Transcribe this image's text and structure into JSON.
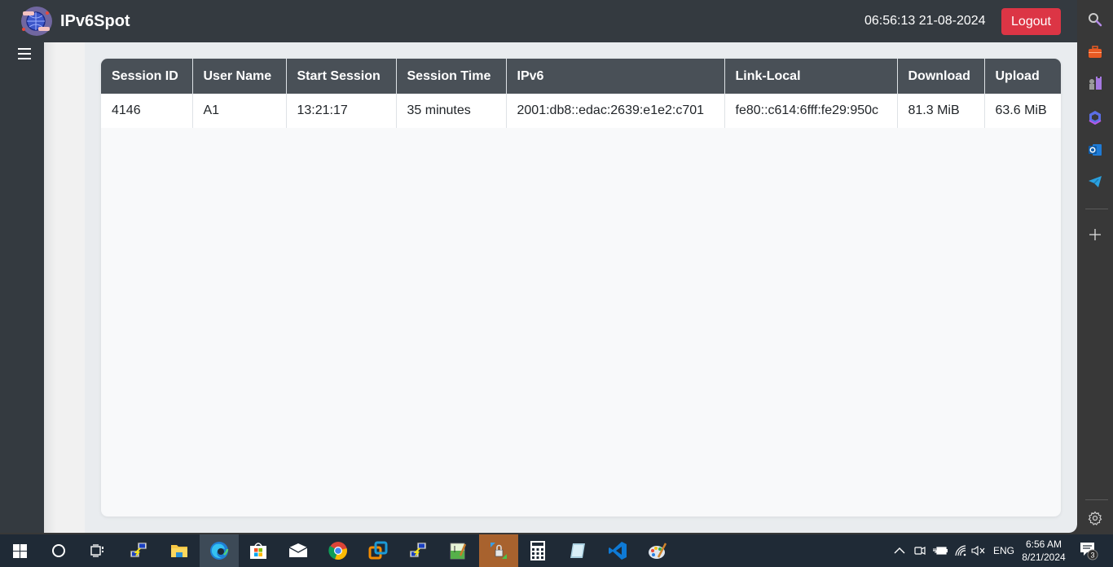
{
  "app": {
    "brand": "IPv6Spot",
    "datetime": "06:56:13 21-08-2024",
    "logout_label": "Logout"
  },
  "table": {
    "headers": [
      "Session ID",
      "User Name",
      "Start Session",
      "Session Time",
      "IPv6",
      "Link-Local",
      "Download",
      "Upload"
    ],
    "rows": [
      [
        "4146",
        "A1",
        "13:21:17",
        "35 minutes",
        "2001:db8::edac:2639:e1e2:c701",
        "fe80::c614:6fff:fe29:950c",
        "81.3 MiB",
        "63.6 MiB"
      ]
    ]
  },
  "edge_sidebar": {
    "icons": [
      "search-icon",
      "toolbox-icon",
      "chess-icon",
      "copilot-icon",
      "outlook-icon",
      "telegram-icon",
      "add-icon",
      "settings-icon"
    ]
  },
  "taskbar": {
    "apps": [
      "start",
      "cortana",
      "task-view",
      "putty",
      "file-explorer",
      "edge",
      "store",
      "mail",
      "chrome",
      "vmware",
      "putty-2",
      "notepad-plus",
      "vpn-lock",
      "calculator",
      "notepad",
      "vscode",
      "paint"
    ],
    "tray": {
      "language": "ENG",
      "time": "6:56 AM",
      "date": "8/21/2024",
      "notification_count": "3"
    }
  },
  "colors": {
    "header_bg": "#343a40",
    "table_header_bg": "#495057",
    "logout_bg": "#dc3545",
    "content_bg": "#e9ecef",
    "card_bg": "#f8f9fa"
  }
}
